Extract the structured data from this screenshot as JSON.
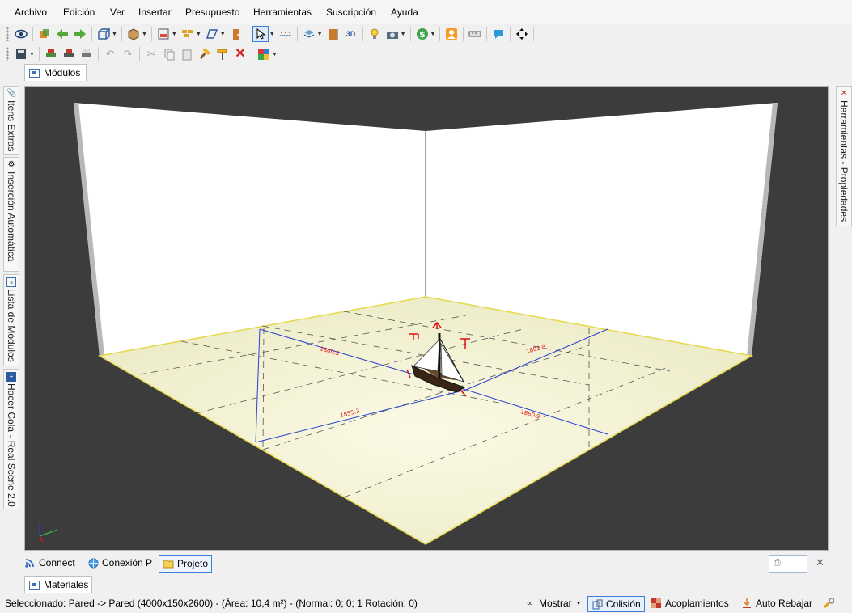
{
  "menu": {
    "items": [
      "Archivo",
      "Edición",
      "Ver",
      "Insertar",
      "Presupuesto",
      "Herramientas",
      "Suscripción",
      "Ayuda"
    ]
  },
  "tabs": {
    "modules_label": "Módulos",
    "materials_label": "Materiales"
  },
  "left_dock": {
    "tabs": [
      "Itens Extras",
      "Inserción Automática",
      "Lista de Módulos",
      "Hacer Cola - Real Scene 2.0"
    ]
  },
  "right_dock": {
    "tab": "Herramientas - Propiedades"
  },
  "bottom_tabs": {
    "connect": "Connect",
    "conexion": "Conexión P",
    "projeto": "Projeto"
  },
  "viewport": {
    "dimension_labels": [
      "1800.5",
      "1802.8",
      "1855.3",
      "1860.9"
    ]
  },
  "status": {
    "selection_text": "Seleccionado: Pared -> Pared (4000x150x2600) - (Área: 10,4 m²) - (Normal: 0; 0; 1 Rotación: 0)",
    "mostrar": "Mostrar",
    "colision": "Colisión",
    "acoplamientos": "Acoplamientos",
    "auto_rebajar": "Auto Rebajar"
  },
  "colors": {
    "background_dark": "#3c3c3c",
    "floor": "#f5f3d6",
    "accent_blue": "#2a3fd2",
    "marker_red": "#e01010",
    "active_border": "#3b7dd8"
  }
}
